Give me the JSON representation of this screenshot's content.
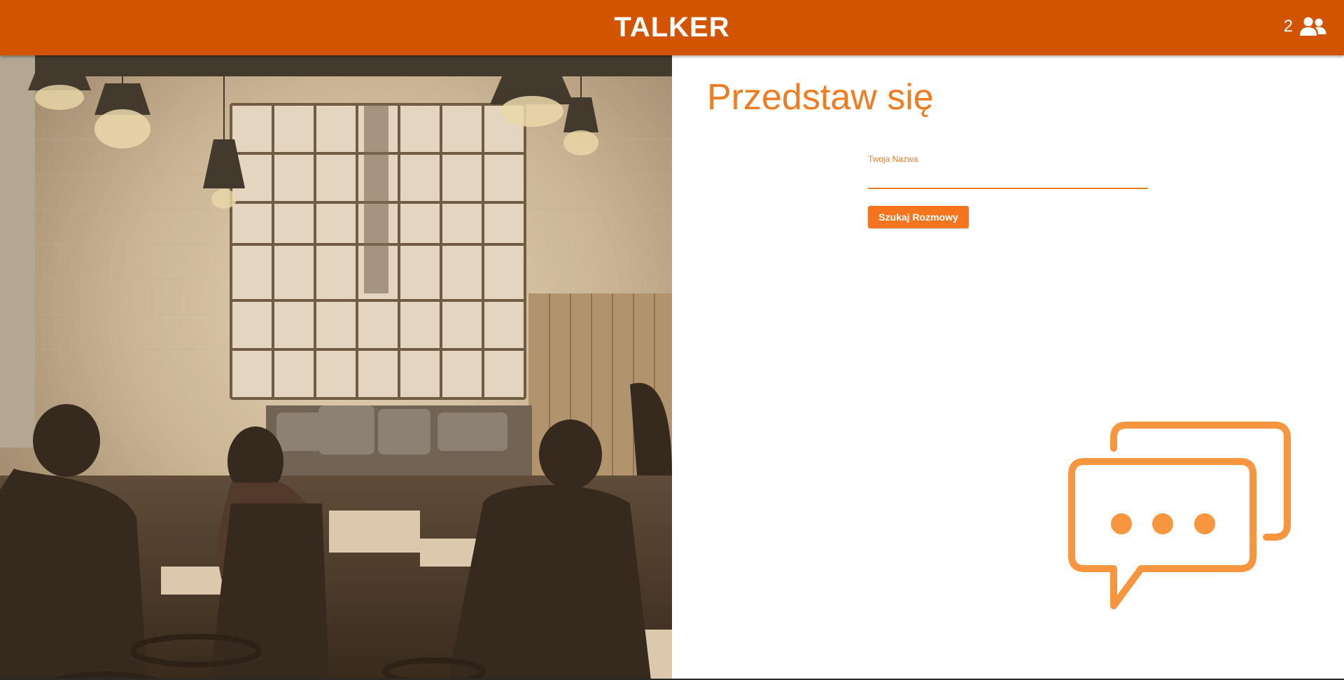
{
  "header": {
    "title": "TALKER",
    "online_count": "2",
    "online_icon": "users-icon",
    "background_color": "#d35400"
  },
  "hero_image": {
    "description_icon": "cafe-photo"
  },
  "form": {
    "heading": "Przedstaw się",
    "name_label": "Twoja Nazwa",
    "name_value": "",
    "submit_label": "Szukaj Rozmowy",
    "accent_color": "#f07c22"
  },
  "decoration": {
    "icon": "chat-bubbles-icon",
    "color": "#f7963f"
  }
}
